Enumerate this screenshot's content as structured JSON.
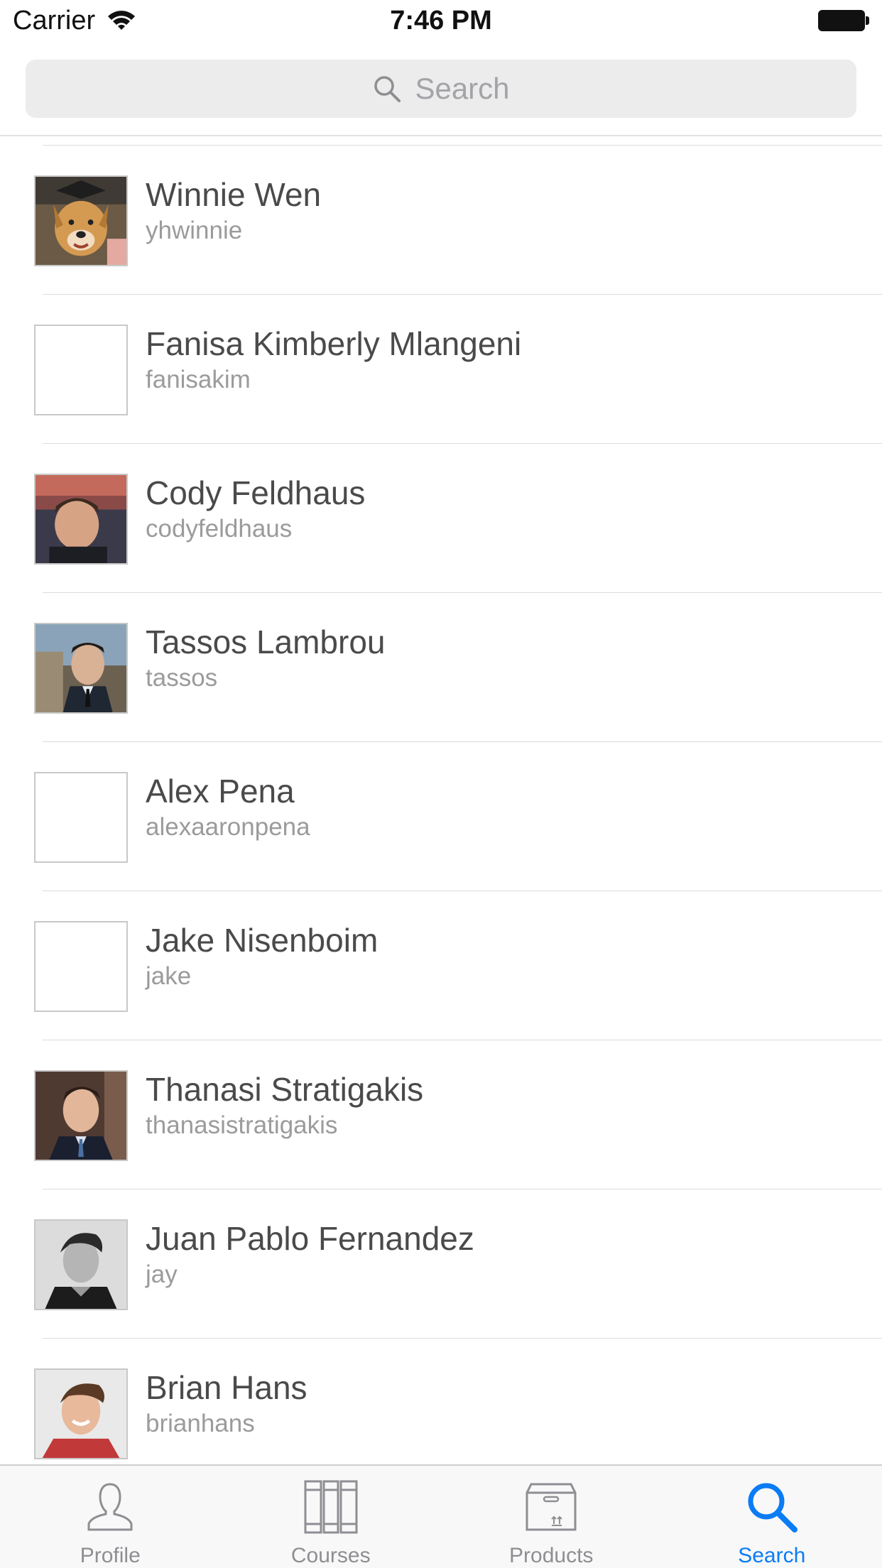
{
  "status_bar": {
    "carrier": "Carrier",
    "time": "7:46 PM"
  },
  "search": {
    "placeholder": "Search",
    "icon": "search-icon"
  },
  "users": [
    {
      "name": "Winnie Wen",
      "handle": "yhwinnie",
      "avatar": "photo-dog"
    },
    {
      "name": "Fanisa Kimberly Mlangeni",
      "handle": "fanisakim",
      "avatar": "blank"
    },
    {
      "name": "Cody Feldhaus",
      "handle": "codyfeldhaus",
      "avatar": "photo-sunset"
    },
    {
      "name": "Tassos Lambrou",
      "handle": "tassos",
      "avatar": "photo-suit-coast"
    },
    {
      "name": "Alex Pena",
      "handle": "alexaaronpena",
      "avatar": "blank"
    },
    {
      "name": "Jake Nisenboim",
      "handle": "jake",
      "avatar": "blank"
    },
    {
      "name": "Thanasi Stratigakis",
      "handle": "thanasistratigakis",
      "avatar": "photo-suit"
    },
    {
      "name": "Juan Pablo Fernandez",
      "handle": "jay",
      "avatar": "photo-bw"
    },
    {
      "name": "Brian Hans",
      "handle": "brianhans",
      "avatar": "photo-red-shirt"
    }
  ],
  "tab_bar": {
    "tabs": [
      {
        "label": "Profile",
        "icon": "person-icon",
        "active": false
      },
      {
        "label": "Courses",
        "icon": "books-icon",
        "active": false
      },
      {
        "label": "Products",
        "icon": "box-icon",
        "active": false
      },
      {
        "label": "Search",
        "icon": "search-icon",
        "active": true
      }
    ],
    "active_color": "#0a7cf5",
    "inactive_color": "#8e8e93"
  }
}
